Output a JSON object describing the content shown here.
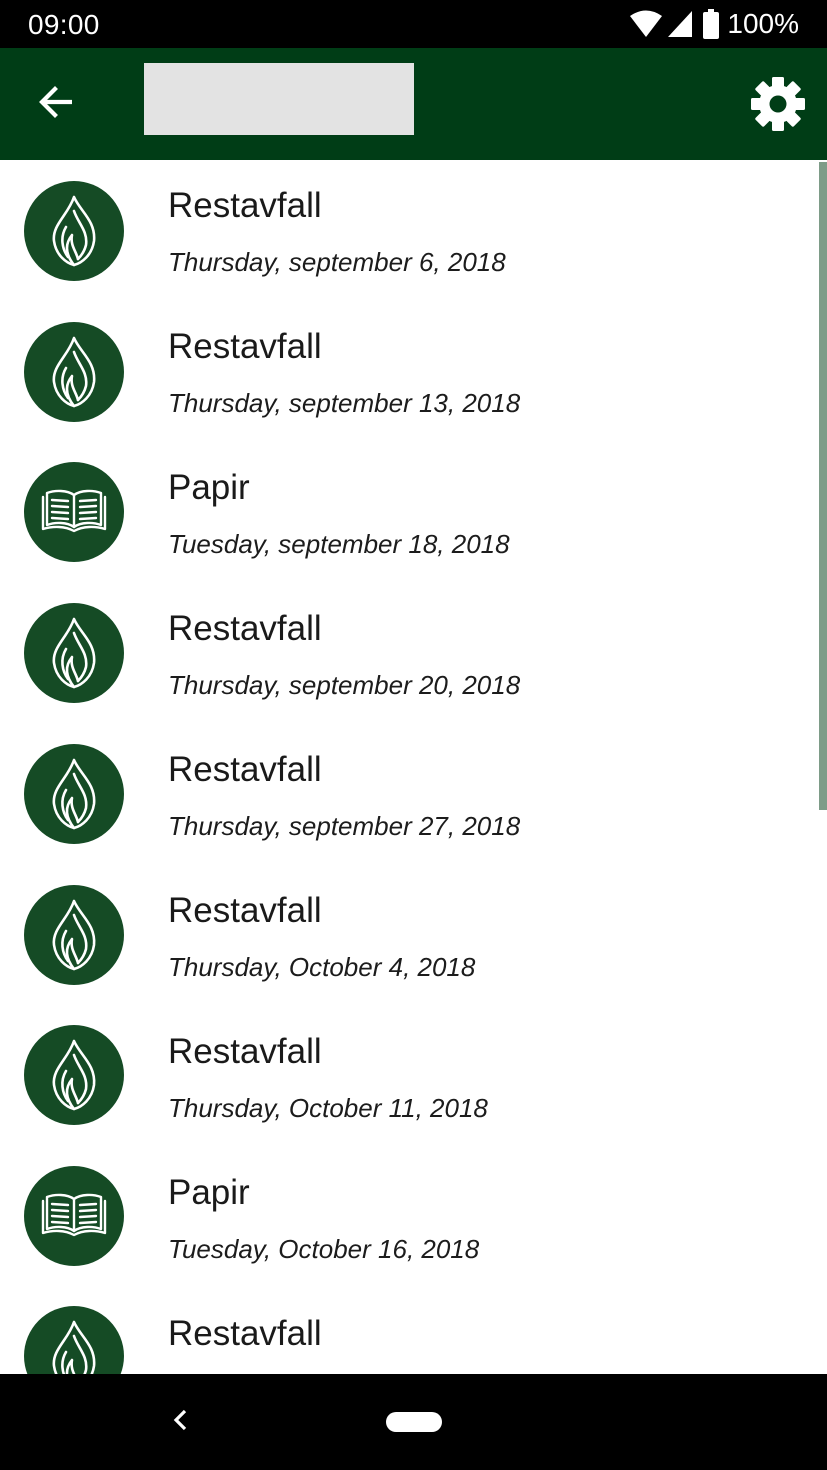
{
  "status_bar": {
    "time": "09:00",
    "battery": "100%",
    "icons": [
      "wifi-icon",
      "signal-icon",
      "battery-icon"
    ]
  },
  "app_bar": {
    "back_icon": "arrow-left-icon",
    "settings_icon": "gear-icon",
    "background_color": "#003d16"
  },
  "list": {
    "items": [
      {
        "type": "Restavfall",
        "date": "Thursday, september 6, 2018",
        "icon": "flame-icon"
      },
      {
        "type": "Restavfall",
        "date": "Thursday, september 13, 2018",
        "icon": "flame-icon"
      },
      {
        "type": "Papir",
        "date": "Tuesday, september 18, 2018",
        "icon": "book-icon"
      },
      {
        "type": "Restavfall",
        "date": "Thursday, september 20, 2018",
        "icon": "flame-icon"
      },
      {
        "type": "Restavfall",
        "date": "Thursday, september 27, 2018",
        "icon": "flame-icon"
      },
      {
        "type": "Restavfall",
        "date": "Thursday, October 4, 2018",
        "icon": "flame-icon"
      },
      {
        "type": "Restavfall",
        "date": "Thursday, October 11, 2018",
        "icon": "flame-icon"
      },
      {
        "type": "Papir",
        "date": "Tuesday, October 16, 2018",
        "icon": "book-icon"
      },
      {
        "type": "Restavfall",
        "date": "",
        "icon": "flame-icon"
      }
    ],
    "avatar_color": "#154b25"
  },
  "nav_bar": {
    "back_icon": "nav-back-icon",
    "home_icon": "home-pill-icon"
  }
}
